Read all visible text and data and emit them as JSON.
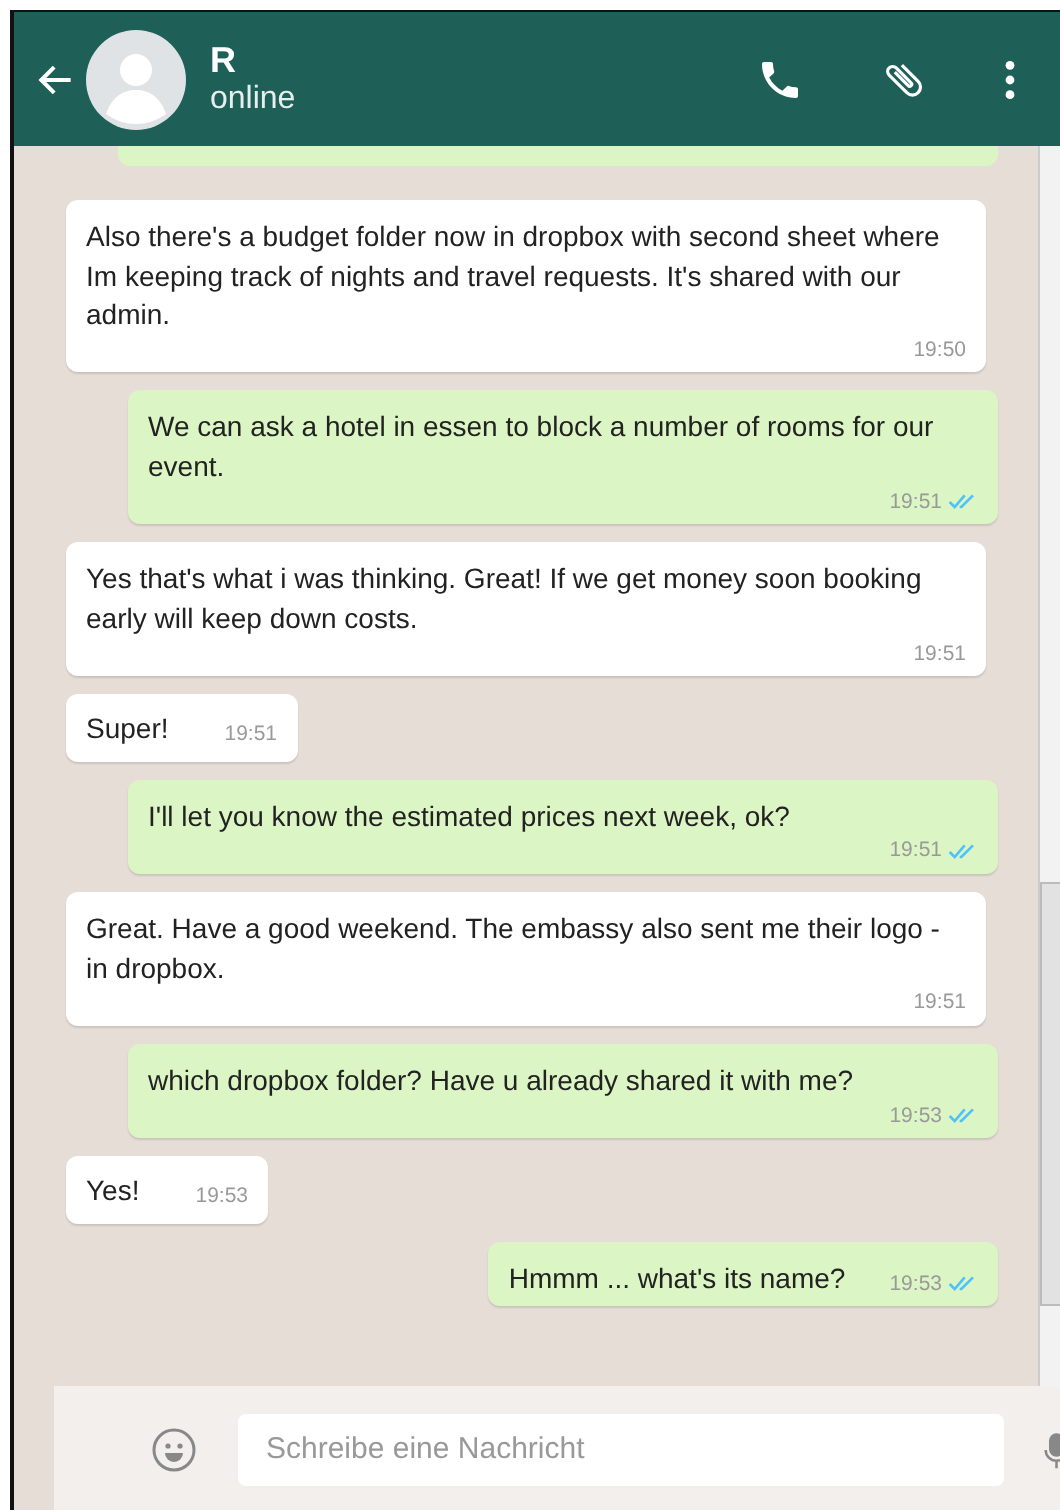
{
  "header": {
    "name": "R",
    "status": "online"
  },
  "messages": [
    {
      "kind": "partial"
    },
    {
      "kind": "in",
      "text": "Also there's a  budget folder now in dropbox with second sheet where Im keeping track of nights and travel requests. It's  shared with our admin.",
      "time": "19:50"
    },
    {
      "kind": "out",
      "text": "We can ask a hotel in essen to block a number of rooms for our event.",
      "time": "19:51",
      "read": true
    },
    {
      "kind": "in",
      "text": "Yes that's  what i was thinking.  Great! If we get money soon booking early  will keep down costs.",
      "time": "19:51"
    },
    {
      "kind": "in",
      "text": "Super!",
      "time": "19:51"
    },
    {
      "kind": "out",
      "text": "I'll let you know the estimated prices next week, ok?",
      "time": "19:51",
      "read": true
    },
    {
      "kind": "in",
      "text": "Great. Have a good weekend. The embassy also sent me their logo - in dropbox.",
      "time": "19:51"
    },
    {
      "kind": "out",
      "text": "which dropbox folder? Have u already shared it with me?",
      "time": "19:53",
      "read": true
    },
    {
      "kind": "in",
      "text": "Yes!",
      "time": "19:53"
    },
    {
      "kind": "out",
      "text": "Hmmm ... what's its name?",
      "time": "19:53",
      "read": true
    }
  ],
  "composer": {
    "placeholder": "Schreibe eine Nachricht"
  }
}
